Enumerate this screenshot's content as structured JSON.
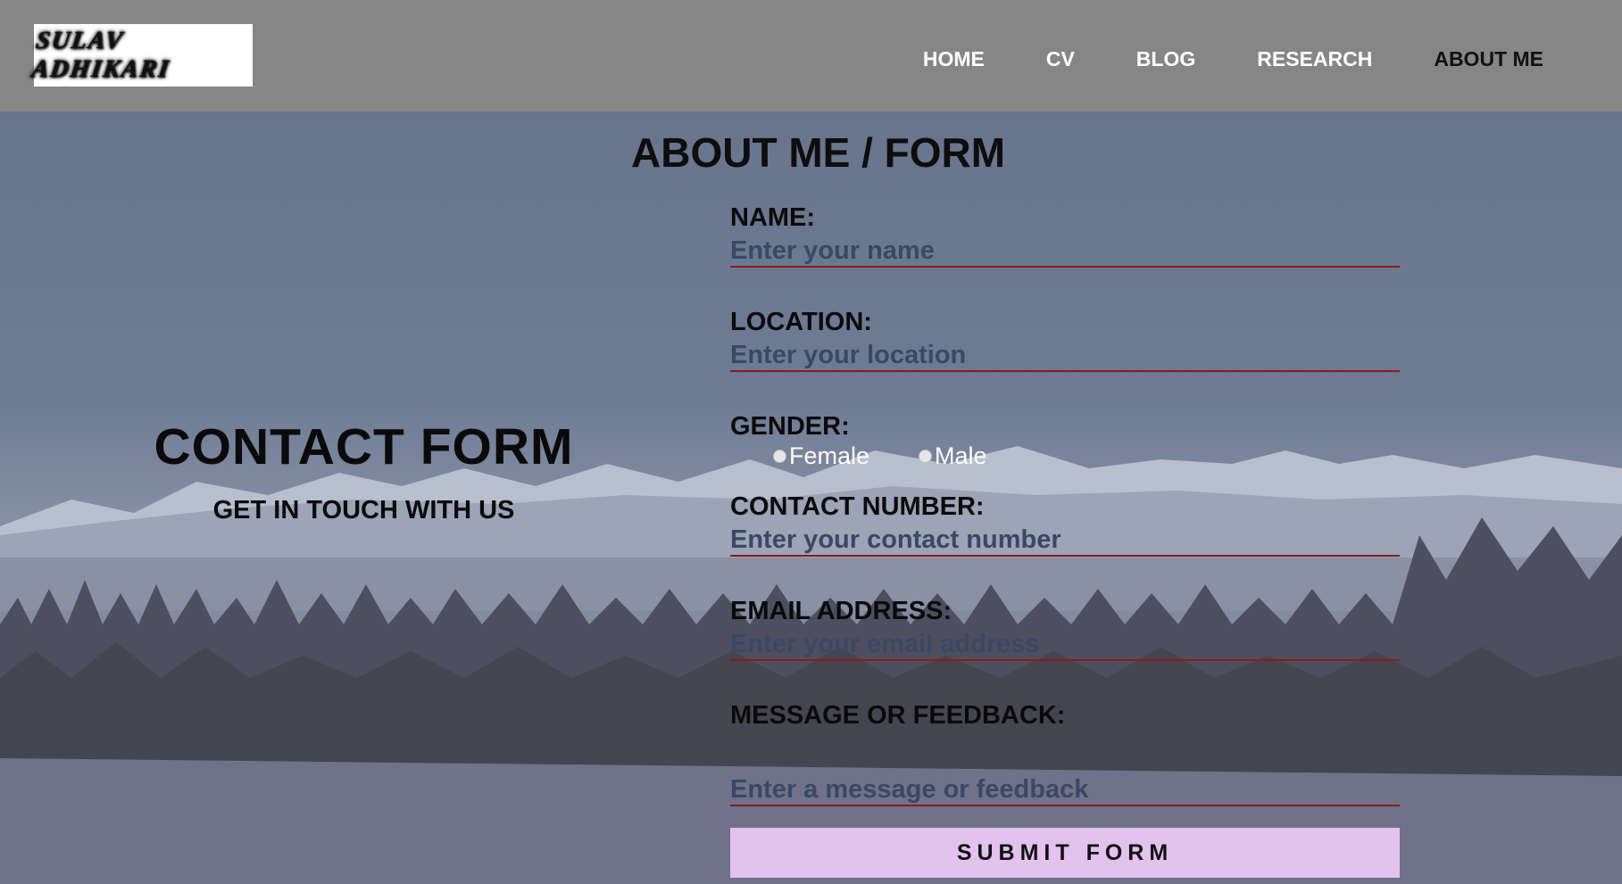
{
  "header": {
    "logo_text": "SULAV ADHIKARI",
    "nav": [
      "HOME",
      "CV",
      "BLOG",
      "RESEARCH",
      "ABOUT ME"
    ],
    "active_nav": "ABOUT ME"
  },
  "page": {
    "title": "ABOUT ME / FORM"
  },
  "left": {
    "title": "CONTACT FORM",
    "subtitle": "GET IN TOUCH WITH US"
  },
  "form": {
    "name_label": "NAME:",
    "name_placeholder": "Enter your name",
    "location_label": "LOCATION:",
    "location_placeholder": "Enter your location",
    "gender_label": "GENDER:",
    "gender_options": [
      "Female",
      "Male"
    ],
    "contact_label": "CONTACT NUMBER:",
    "contact_placeholder": "Enter your contact number",
    "email_label": "EMAIL ADDRESS:",
    "email_placeholder": "Enter your email address",
    "message_label": "MESSAGE OR FEEDBACK:",
    "message_placeholder": "Enter a message or feedback",
    "submit_label": "SUBMIT FORM"
  },
  "colors": {
    "header_bg": "#868686",
    "input_underline": "#8b1a1a",
    "submit_bg": "#e3c2ee"
  }
}
